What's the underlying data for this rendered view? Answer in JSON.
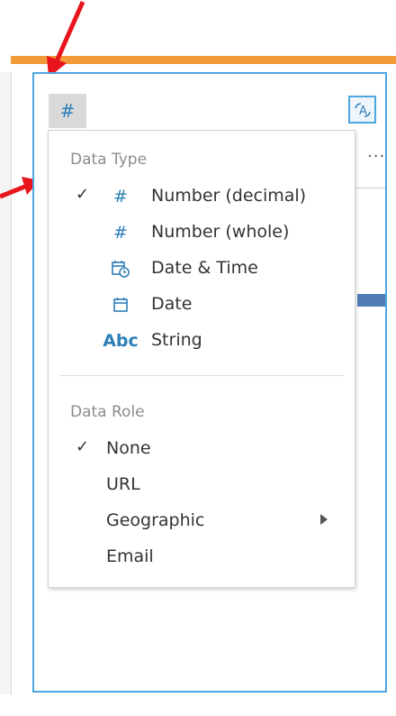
{
  "header": {
    "type_button_icon": "#",
    "rename_icon": "rename-field-icon",
    "more_icon_text": "...",
    "accent_color": "#f29a38",
    "selection_border_color": "#4ea6e0"
  },
  "menu": {
    "data_type_title": "Data Type",
    "data_types": [
      {
        "label": "Number (decimal)",
        "icon": "#",
        "icon_name": "number-decimal-icon",
        "checked": true
      },
      {
        "label": "Number (whole)",
        "icon": "#",
        "icon_name": "number-whole-icon",
        "checked": false
      },
      {
        "label": "Date & Time",
        "icon": "calendar-clock",
        "icon_name": "datetime-icon",
        "checked": false
      },
      {
        "label": "Date",
        "icon": "calendar",
        "icon_name": "date-icon",
        "checked": false
      },
      {
        "label": "String",
        "icon": "Abc",
        "icon_name": "string-icon",
        "checked": false
      }
    ],
    "data_role_title": "Data Role",
    "data_roles": [
      {
        "label": "None",
        "checked": true,
        "has_submenu": false
      },
      {
        "label": "URL",
        "checked": false,
        "has_submenu": false
      },
      {
        "label": "Geographic",
        "checked": false,
        "has_submenu": true
      },
      {
        "label": "Email",
        "checked": false,
        "has_submenu": false
      }
    ],
    "check_glyph": "✓",
    "abc_text": "Abc"
  }
}
